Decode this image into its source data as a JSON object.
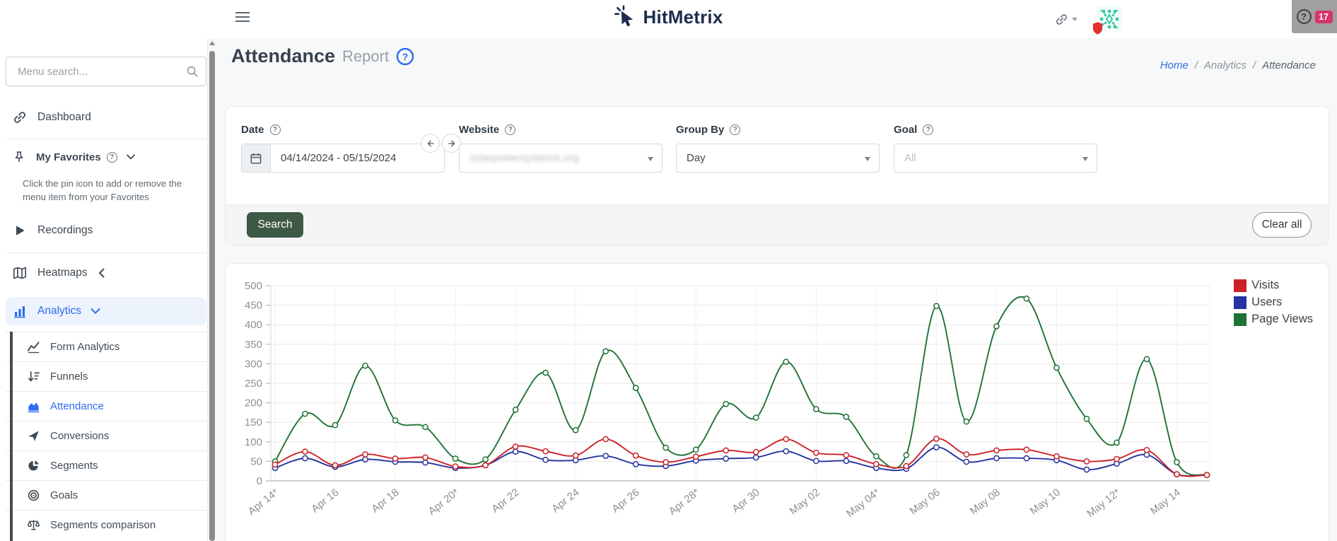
{
  "header": {
    "brand": "HitMetrix",
    "menu_icon": "hamburger-icon",
    "right_icons": [
      "link-icon",
      "caret-down-icon",
      "identicon-avatar",
      "shield-icon"
    ],
    "help_widget": {
      "icon": "question-circle-icon",
      "badge_count": "17"
    }
  },
  "sidebar": {
    "search_placeholder": "Menu search...",
    "search_icon": "search-icon",
    "dashboard": {
      "label": "Dashboard",
      "icon": "link-icon"
    },
    "favorites": {
      "label": "My Favorites",
      "icon": "pin-icon",
      "help_icon": "question-circle-icon",
      "chevron": "down",
      "hint": "Click the pin icon to add or remove the menu item from your Favorites"
    },
    "main_items": [
      {
        "label": "Recordings",
        "icon": "play-icon",
        "chevron": null,
        "active": false,
        "divider_after": true
      },
      {
        "label": "Heatmaps",
        "icon": "map-icon",
        "chevron": "left",
        "active": false,
        "divider_after": false
      },
      {
        "label": "Analytics",
        "icon": "bar-chart-icon",
        "chevron": "down",
        "active": true,
        "divider_after": false
      }
    ],
    "analytics_submenu": [
      {
        "label": "Form Analytics",
        "icon": "line-chart-icon",
        "active": false
      },
      {
        "label": "Funnels",
        "icon": "funnel-icon",
        "active": false
      },
      {
        "label": "Attendance",
        "icon": "area-chart-icon",
        "active": true
      },
      {
        "label": "Conversions",
        "icon": "send-icon",
        "active": false
      },
      {
        "label": "Segments",
        "icon": "pie-chart-icon",
        "active": false
      },
      {
        "label": "Goals",
        "icon": "target-icon",
        "active": false
      },
      {
        "label": "Segments comparison",
        "icon": "scale-icon",
        "active": false
      }
    ]
  },
  "page": {
    "title": "Attendance",
    "subtitle": "Report",
    "title_help_icon": "question-circle-icon",
    "breadcrumb": [
      "Home",
      "Analytics",
      "Attendance"
    ]
  },
  "filters": {
    "date": {
      "label": "Date",
      "value": "04/14/2024 - 05/15/2024",
      "icon": "calendar-icon",
      "prev_icon": "arrow-left-icon",
      "next_icon": "arrow-right-icon"
    },
    "website": {
      "label": "Website",
      "value": "solarpowersystems.org",
      "redacted": true
    },
    "group_by": {
      "label": "Group By",
      "value": "Day"
    },
    "goal": {
      "label": "Goal",
      "value": "All"
    },
    "search_label": "Search",
    "clear_label": "Clear all"
  },
  "chart_data": {
    "type": "line",
    "title": "",
    "xlabel": "",
    "ylabel": "",
    "ylim": [
      0,
      500
    ],
    "ytick_step": 50,
    "grid": true,
    "legend_position": "top-right",
    "curve": "smooth",
    "x": [
      "Apr 14",
      "Apr 15",
      "Apr 16",
      "Apr 17",
      "Apr 18",
      "Apr 19",
      "Apr 20",
      "Apr 21",
      "Apr 22",
      "Apr 23",
      "Apr 24",
      "Apr 25",
      "Apr 26",
      "Apr 27",
      "Apr 28",
      "Apr 29",
      "Apr 30",
      "May 01",
      "May 02",
      "May 03",
      "May 04",
      "May 05",
      "May 06",
      "May 07",
      "May 08",
      "May 09",
      "May 10",
      "May 11",
      "May 12",
      "May 13",
      "May 14",
      "May 15"
    ],
    "x_tick_labels": [
      "Apr 14*",
      "Apr 16",
      "Apr 18",
      "Apr 20*",
      "Apr 22",
      "Apr 24",
      "Apr 26",
      "Apr 28*",
      "Apr 30",
      "May 02",
      "May 04*",
      "May 06",
      "May 08",
      "May 10",
      "May 12*",
      "May 14"
    ],
    "series": [
      {
        "name": "Visits",
        "color": "#cb2127",
        "values": [
          42,
          75,
          40,
          68,
          57,
          60,
          37,
          40,
          88,
          76,
          65,
          107,
          65,
          48,
          62,
          78,
          74,
          107,
          72,
          66,
          43,
          38,
          108,
          68,
          78,
          80,
          63,
          50,
          56,
          79,
          17,
          15
        ]
      },
      {
        "name": "Users",
        "color": "#2434a0",
        "values": [
          33,
          58,
          36,
          55,
          49,
          47,
          33,
          40,
          75,
          54,
          53,
          64,
          43,
          38,
          52,
          57,
          60,
          76,
          51,
          51,
          33,
          31,
          86,
          49,
          58,
          58,
          53,
          29,
          44,
          67,
          17,
          15
        ]
      },
      {
        "name": "Page Views",
        "color": "#1e7235",
        "values": [
          50,
          172,
          143,
          295,
          155,
          138,
          57,
          55,
          182,
          277,
          130,
          332,
          238,
          85,
          80,
          197,
          162,
          305,
          184,
          164,
          63,
          66,
          448,
          152,
          396,
          467,
          290,
          159,
          98,
          312,
          48,
          15
        ]
      }
    ]
  }
}
